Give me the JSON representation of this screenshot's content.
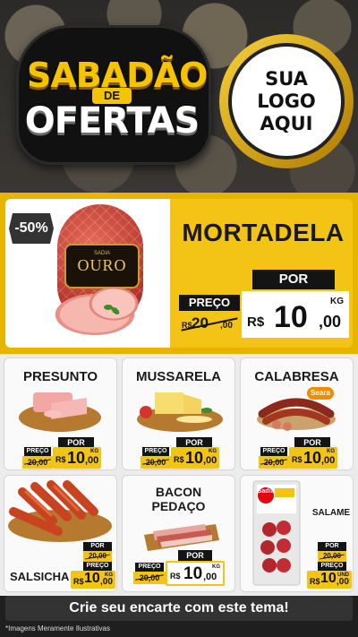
{
  "header": {
    "title_line1": "SABADÃO",
    "title_de": "DE",
    "title_line2": "OFERTAS",
    "logo_lines": [
      "SUA",
      "LOGO",
      "AQUI"
    ]
  },
  "featured": {
    "discount": "-50%",
    "brand_small": "SADIA",
    "brand": "OURO",
    "name": "MORTADELA",
    "por_label": "POR",
    "preco_label": "PREÇO",
    "old_currency": "R$",
    "old_value": "20",
    "old_cents": ",00",
    "new_currency": "R$",
    "new_value": "10",
    "new_cents": ",00",
    "unit": "KG"
  },
  "products": [
    {
      "name": "PRESUNTO",
      "preco_label": "PREÇO",
      "por_label": "POR",
      "old_price": "20,00",
      "currency": "R$",
      "value": "10",
      "cents": ",00",
      "unit": "KG"
    },
    {
      "name": "MUSSARELA",
      "preco_label": "PREÇO",
      "por_label": "POR",
      "old_price": "20,00",
      "currency": "R$",
      "value": "10",
      "cents": ",00",
      "unit": "KG"
    },
    {
      "name": "CALABRESA",
      "brand": "Seara",
      "preco_label": "PREÇO",
      "por_label": "POR",
      "old_price": "20,00",
      "currency": "R$",
      "value": "10",
      "cents": ",00",
      "unit": "KG"
    },
    {
      "name": "SALSICHA",
      "preco_label": "PREÇO",
      "por_label": "POR",
      "old_price": "20,00",
      "currency": "R$",
      "value": "10",
      "cents": ",00",
      "unit": "KG"
    },
    {
      "name_line1": "BACON",
      "name_line2": "PEDAÇO",
      "preco_label": "PREÇO",
      "por_label": "POR",
      "old_price": "20,00",
      "currency": "R$",
      "value": "10",
      "cents": ",00",
      "unit": "KG"
    },
    {
      "name": "SALAME",
      "brand": "Sadia",
      "preco_label": "PREÇO",
      "por_label": "POR",
      "old_price": "20,00",
      "currency": "R$",
      "value": "10",
      "cents": ",00",
      "unit": "UND"
    }
  ],
  "cta": "Crie seu encarte com este tema!",
  "disclaimer": "*Imagens Meramente Ilustrativas",
  "colors": {
    "accent": "#f3c316",
    "dark": "#141414",
    "cta_bg": "#333333"
  }
}
